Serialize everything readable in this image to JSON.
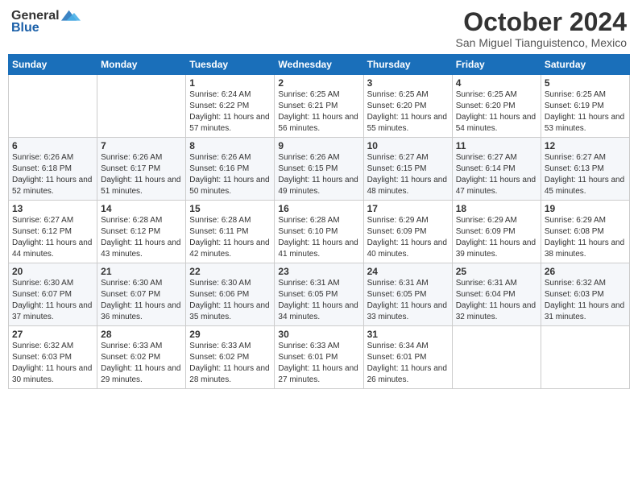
{
  "header": {
    "logo_general": "General",
    "logo_blue": "Blue",
    "month_title": "October 2024",
    "location": "San Miguel Tianguistenco, Mexico"
  },
  "weekdays": [
    "Sunday",
    "Monday",
    "Tuesday",
    "Wednesday",
    "Thursday",
    "Friday",
    "Saturday"
  ],
  "weeks": [
    [
      {
        "day": "",
        "info": ""
      },
      {
        "day": "",
        "info": ""
      },
      {
        "day": "1",
        "info": "Sunrise: 6:24 AM\nSunset: 6:22 PM\nDaylight: 11 hours and 57 minutes."
      },
      {
        "day": "2",
        "info": "Sunrise: 6:25 AM\nSunset: 6:21 PM\nDaylight: 11 hours and 56 minutes."
      },
      {
        "day": "3",
        "info": "Sunrise: 6:25 AM\nSunset: 6:20 PM\nDaylight: 11 hours and 55 minutes."
      },
      {
        "day": "4",
        "info": "Sunrise: 6:25 AM\nSunset: 6:20 PM\nDaylight: 11 hours and 54 minutes."
      },
      {
        "day": "5",
        "info": "Sunrise: 6:25 AM\nSunset: 6:19 PM\nDaylight: 11 hours and 53 minutes."
      }
    ],
    [
      {
        "day": "6",
        "info": "Sunrise: 6:26 AM\nSunset: 6:18 PM\nDaylight: 11 hours and 52 minutes."
      },
      {
        "day": "7",
        "info": "Sunrise: 6:26 AM\nSunset: 6:17 PM\nDaylight: 11 hours and 51 minutes."
      },
      {
        "day": "8",
        "info": "Sunrise: 6:26 AM\nSunset: 6:16 PM\nDaylight: 11 hours and 50 minutes."
      },
      {
        "day": "9",
        "info": "Sunrise: 6:26 AM\nSunset: 6:15 PM\nDaylight: 11 hours and 49 minutes."
      },
      {
        "day": "10",
        "info": "Sunrise: 6:27 AM\nSunset: 6:15 PM\nDaylight: 11 hours and 48 minutes."
      },
      {
        "day": "11",
        "info": "Sunrise: 6:27 AM\nSunset: 6:14 PM\nDaylight: 11 hours and 47 minutes."
      },
      {
        "day": "12",
        "info": "Sunrise: 6:27 AM\nSunset: 6:13 PM\nDaylight: 11 hours and 45 minutes."
      }
    ],
    [
      {
        "day": "13",
        "info": "Sunrise: 6:27 AM\nSunset: 6:12 PM\nDaylight: 11 hours and 44 minutes."
      },
      {
        "day": "14",
        "info": "Sunrise: 6:28 AM\nSunset: 6:12 PM\nDaylight: 11 hours and 43 minutes."
      },
      {
        "day": "15",
        "info": "Sunrise: 6:28 AM\nSunset: 6:11 PM\nDaylight: 11 hours and 42 minutes."
      },
      {
        "day": "16",
        "info": "Sunrise: 6:28 AM\nSunset: 6:10 PM\nDaylight: 11 hours and 41 minutes."
      },
      {
        "day": "17",
        "info": "Sunrise: 6:29 AM\nSunset: 6:09 PM\nDaylight: 11 hours and 40 minutes."
      },
      {
        "day": "18",
        "info": "Sunrise: 6:29 AM\nSunset: 6:09 PM\nDaylight: 11 hours and 39 minutes."
      },
      {
        "day": "19",
        "info": "Sunrise: 6:29 AM\nSunset: 6:08 PM\nDaylight: 11 hours and 38 minutes."
      }
    ],
    [
      {
        "day": "20",
        "info": "Sunrise: 6:30 AM\nSunset: 6:07 PM\nDaylight: 11 hours and 37 minutes."
      },
      {
        "day": "21",
        "info": "Sunrise: 6:30 AM\nSunset: 6:07 PM\nDaylight: 11 hours and 36 minutes."
      },
      {
        "day": "22",
        "info": "Sunrise: 6:30 AM\nSunset: 6:06 PM\nDaylight: 11 hours and 35 minutes."
      },
      {
        "day": "23",
        "info": "Sunrise: 6:31 AM\nSunset: 6:05 PM\nDaylight: 11 hours and 34 minutes."
      },
      {
        "day": "24",
        "info": "Sunrise: 6:31 AM\nSunset: 6:05 PM\nDaylight: 11 hours and 33 minutes."
      },
      {
        "day": "25",
        "info": "Sunrise: 6:31 AM\nSunset: 6:04 PM\nDaylight: 11 hours and 32 minutes."
      },
      {
        "day": "26",
        "info": "Sunrise: 6:32 AM\nSunset: 6:03 PM\nDaylight: 11 hours and 31 minutes."
      }
    ],
    [
      {
        "day": "27",
        "info": "Sunrise: 6:32 AM\nSunset: 6:03 PM\nDaylight: 11 hours and 30 minutes."
      },
      {
        "day": "28",
        "info": "Sunrise: 6:33 AM\nSunset: 6:02 PM\nDaylight: 11 hours and 29 minutes."
      },
      {
        "day": "29",
        "info": "Sunrise: 6:33 AM\nSunset: 6:02 PM\nDaylight: 11 hours and 28 minutes."
      },
      {
        "day": "30",
        "info": "Sunrise: 6:33 AM\nSunset: 6:01 PM\nDaylight: 11 hours and 27 minutes."
      },
      {
        "day": "31",
        "info": "Sunrise: 6:34 AM\nSunset: 6:01 PM\nDaylight: 11 hours and 26 minutes."
      },
      {
        "day": "",
        "info": ""
      },
      {
        "day": "",
        "info": ""
      }
    ]
  ]
}
